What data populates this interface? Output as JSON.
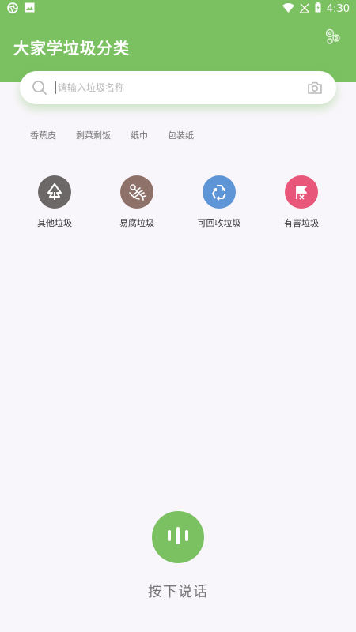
{
  "status_bar": {
    "time": "4:30",
    "left_icons": [
      "aperture-icon",
      "image-icon"
    ],
    "right_icons": [
      "wifi-icon",
      "signal-off-icon",
      "battery-icon"
    ]
  },
  "header": {
    "title": "大家学垃圾分类",
    "settings_icon": "settings-icon",
    "background_color": "#7bc162"
  },
  "search": {
    "placeholder": "请输入垃圾名称",
    "value": "",
    "search_icon": "search-icon",
    "camera_icon": "camera-icon"
  },
  "hot_words": [
    "香蕉皮",
    "剩菜剩饭",
    "纸巾",
    "包装纸"
  ],
  "categories": [
    {
      "label": "其他垃圾",
      "color": "#6d6868",
      "icon": "tree-icon"
    },
    {
      "label": "易腐垃圾",
      "color": "#8e7169",
      "icon": "fish-bone-icon"
    },
    {
      "label": "可回收垃圾",
      "color": "#5e95d6",
      "icon": "recycle-icon"
    },
    {
      "label": "有害垃圾",
      "color": "#e8567a",
      "icon": "flag-icon"
    }
  ],
  "voice": {
    "label": "按下说话",
    "icon": "voice-bars-icon",
    "color": "#7bc162"
  }
}
